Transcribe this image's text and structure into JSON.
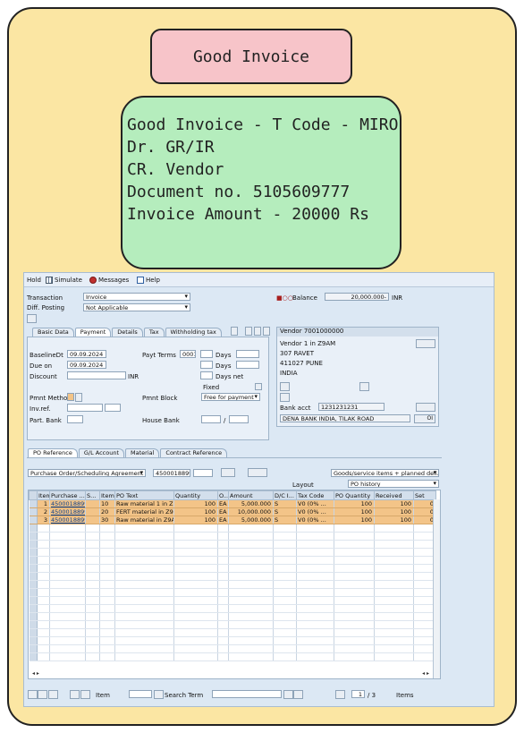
{
  "note": {
    "title": "Good Invoice",
    "lines": [
      "Good Invoice - T Code - MIRO",
      "Dr. GR/IR",
      "CR. Vendor",
      "",
      "Document no. 5105609777",
      "Invoice Amount - 20000 Rs"
    ]
  },
  "sap": {
    "toolbar": {
      "hold": "Hold",
      "simulate": "Simulate",
      "messages": "Messages",
      "help": "Help"
    },
    "header": {
      "transaction_label": "Transaction",
      "transaction_value": "Invoice",
      "diff_label": "Diff. Posting",
      "diff_value": "Not Applicable",
      "balance_label": "Balance",
      "balance_value": "20,000.000-",
      "currency": "INR"
    },
    "tabs": [
      "Basic Data",
      "Payment",
      "Details",
      "Tax",
      "Withholding tax"
    ],
    "active_tab": "Payment",
    "payment": {
      "baseline_label": "BaselineDt",
      "baseline_value": "09.09.2024",
      "due_label": "Due on",
      "due_value": "09.09.2024",
      "discount_label": "Discount",
      "discount_currency": "INR",
      "pmnt_method_label": "Pmnt Method",
      "invref_label": "Inv.ref.",
      "partbank_label": "Part. Bank",
      "payt_terms_label": "Payt Terms",
      "payt_terms_value": "0001",
      "days1": "Days",
      "days2": "Days",
      "days_net": "Days net",
      "fixed": "Fixed",
      "pmnt_block_label": "Pmnt Block",
      "pmnt_block_value": "Free for payment",
      "house_bank_label": "House Bank",
      "slash": "/"
    },
    "vendor": {
      "title": "Vendor 7001000000",
      "name": "Vendor 1 in Z9AM",
      "street": "307 RAVET",
      "city": "411027 PUNE",
      "country": "INDIA",
      "bank_acct_label": "Bank acct",
      "bank_acct_value": "1231231231",
      "bank_name": "DENA BANK INDIA, TILAK ROAD",
      "oi": "OI"
    },
    "lower_tabs": [
      "PO Reference",
      "G/L Account",
      "Material",
      "Contract Reference"
    ],
    "po": {
      "ref_type": "Purchase Order/Scheduling Agreement",
      "po_number": "4500018899",
      "item_type": "Goods/service items + planned deli...",
      "layout_label": "Layout",
      "layout_value": "PO history"
    },
    "table": {
      "columns": [
        "Item",
        "Purchase ...",
        "S...",
        "Item",
        "PO Text",
        "Quantity",
        "O...",
        "Amount",
        "D/C I...",
        "Tax Code",
        "PO Quantity",
        "Received",
        "Set"
      ],
      "rows": [
        [
          "1",
          "4500018899",
          "",
          "10",
          "Raw material 1 in Z...",
          "100",
          "EA",
          "5,000.000",
          "S",
          "V0 (0% ...",
          "100",
          "100",
          "0"
        ],
        [
          "2",
          "4500018899",
          "",
          "20",
          "FERT material in Z9...",
          "100",
          "EA",
          "10,000.000",
          "S",
          "V0 (0% ...",
          "100",
          "100",
          "0"
        ],
        [
          "3",
          "4500018899",
          "",
          "30",
          "Raw material in Z9A...",
          "100",
          "EA",
          "5,000.000",
          "S",
          "V0 (0% ...",
          "100",
          "100",
          "0"
        ]
      ]
    },
    "footer": {
      "item_label": "Item",
      "search_label": "Search Term",
      "page_current": "1",
      "page_total": "/ 3",
      "items_label": "Items"
    }
  },
  "colors": {
    "card": "#fbe6a3",
    "title_box": "#f7c4c9",
    "note_box": "#b5edbd",
    "row_highlight": "#f3c488"
  }
}
